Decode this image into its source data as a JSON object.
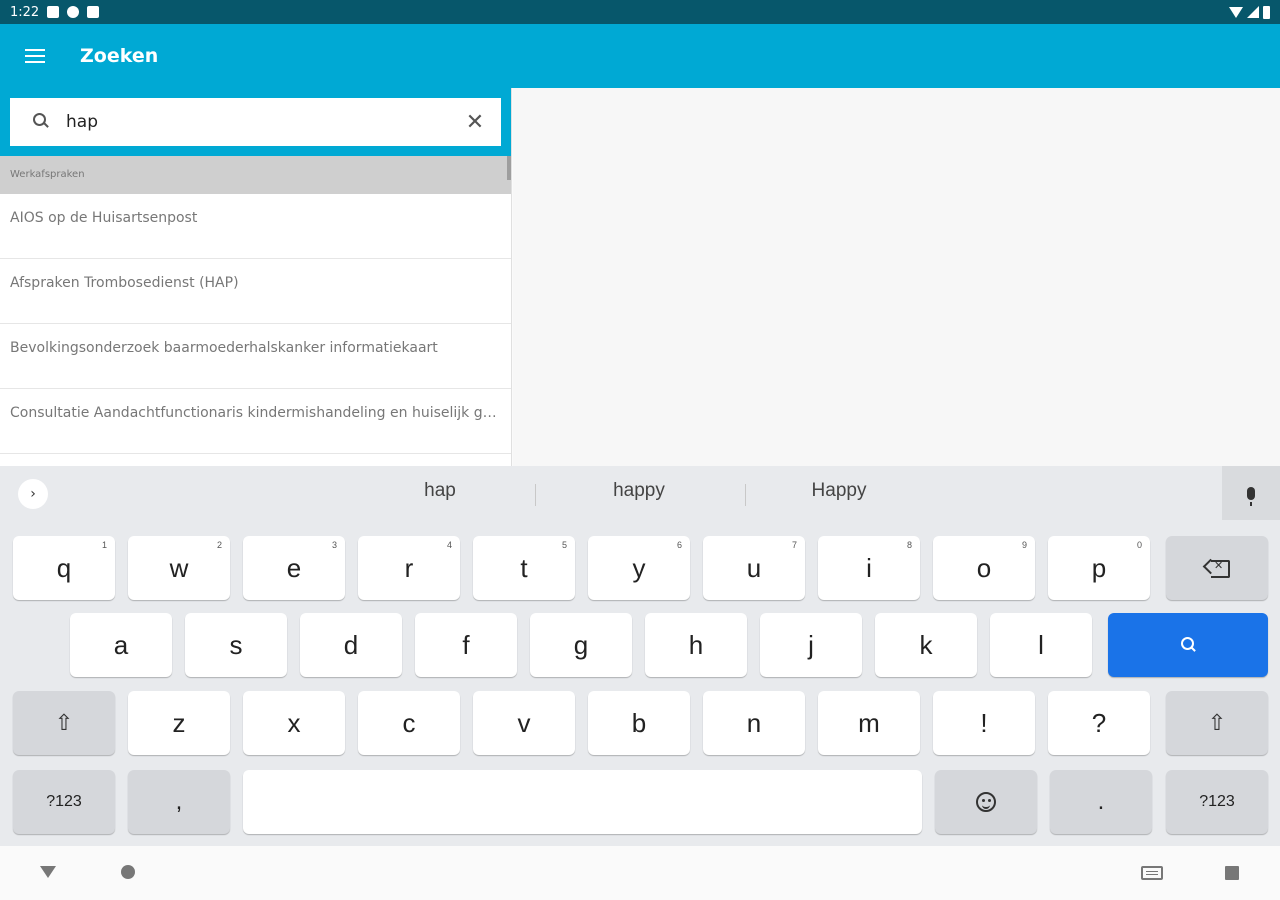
{
  "status_bar": {
    "time": "1:22"
  },
  "app_bar": {
    "title": "Zoeken"
  },
  "search": {
    "value": "hap",
    "placeholder": ""
  },
  "results": {
    "section_header": "Werkafspraken",
    "items": [
      {
        "label": "AIOS op de Huisartsenpost"
      },
      {
        "label": "Afspraken Trombosedienst (HAP)"
      },
      {
        "label": "Bevolkingsonderzoek baarmoederhalskanker informatiekaart"
      },
      {
        "label": "Consultatie Aandachtfunctionaris kindermishandeling en huiselijk geweld"
      }
    ]
  },
  "keyboard": {
    "suggestions": [
      "hap",
      "happy",
      "Happy"
    ],
    "row1": [
      {
        "k": "q",
        "h": "1"
      },
      {
        "k": "w",
        "h": "2"
      },
      {
        "k": "e",
        "h": "3"
      },
      {
        "k": "r",
        "h": "4"
      },
      {
        "k": "t",
        "h": "5"
      },
      {
        "k": "y",
        "h": "6"
      },
      {
        "k": "u",
        "h": "7"
      },
      {
        "k": "i",
        "h": "8"
      },
      {
        "k": "o",
        "h": "9"
      },
      {
        "k": "p",
        "h": "0"
      }
    ],
    "row2": [
      "a",
      "s",
      "d",
      "f",
      "g",
      "h",
      "j",
      "k",
      "l"
    ],
    "row3": [
      "z",
      "x",
      "c",
      "v",
      "b",
      "n",
      "m",
      "!",
      "?"
    ],
    "symbols_label": "?123",
    "comma": ",",
    "period": "."
  },
  "colors": {
    "status_bar": "#07576b",
    "app_bar": "#00a9d4",
    "search_key": "#1a73e8"
  },
  "icons": {
    "menu": "menu-icon",
    "search": "search-icon",
    "clear": "close-icon",
    "backspace": "backspace-icon",
    "shift": "shift-icon",
    "emoji": "emoji-icon",
    "mic": "mic-icon"
  }
}
